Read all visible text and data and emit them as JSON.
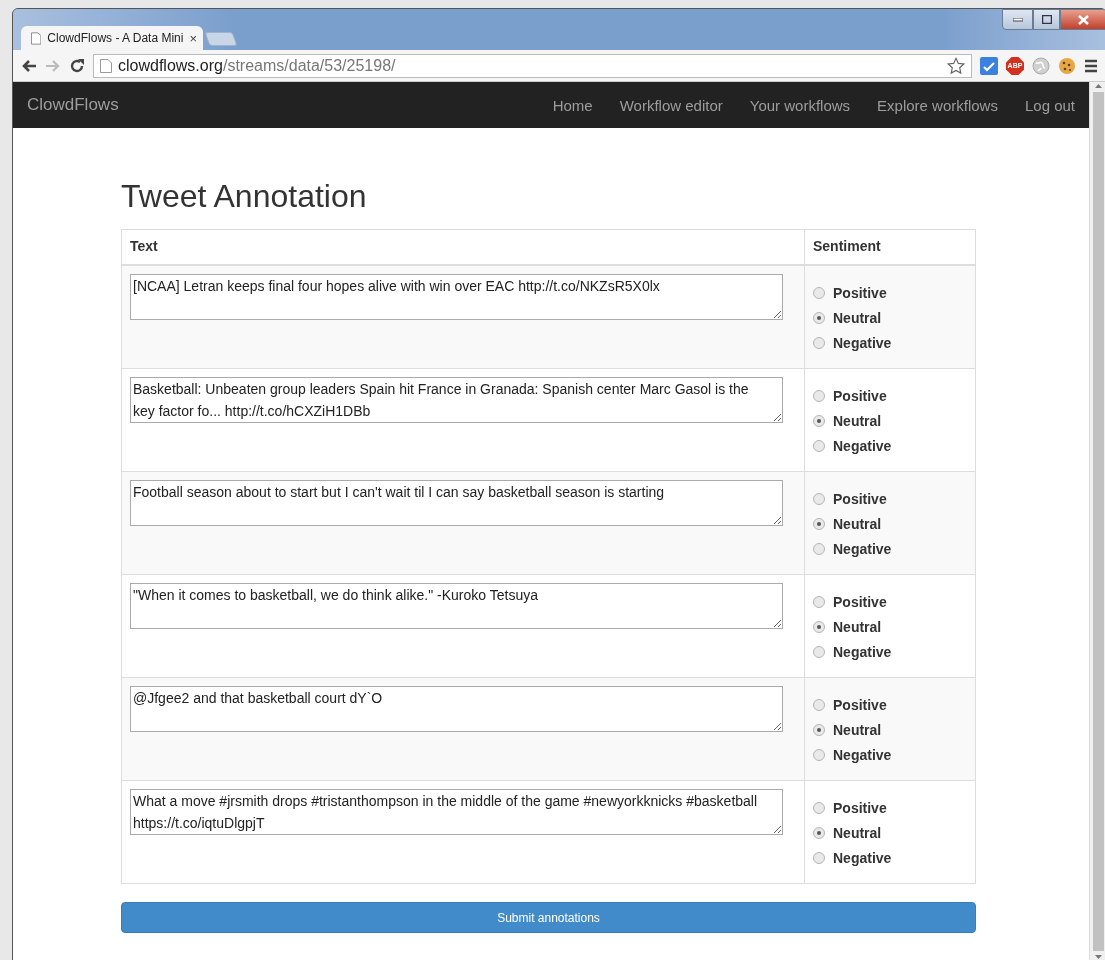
{
  "browser": {
    "tab_title": "ClowdFlows - A Data Mini",
    "tab_close": "×",
    "url_host": "clowdflows.org",
    "url_path": "/streams/data/53/25198/",
    "extension_badge": "ABP"
  },
  "navbar": {
    "brand": "ClowdFlows",
    "links": [
      "Home",
      "Workflow editor",
      "Your workflows",
      "Explore workflows",
      "Log out"
    ]
  },
  "page": {
    "title": "Tweet Annotation",
    "columns": [
      "Text",
      "Sentiment"
    ],
    "rows": [
      {
        "text": "[NCAA] Letran keeps final four hopes alive with win over EAC http://t.co/NKZsR5X0lx",
        "options": [
          {
            "label": "Positive",
            "selected": false
          },
          {
            "label": "Neutral",
            "selected": true
          },
          {
            "label": "Negative",
            "selected": false
          }
        ]
      },
      {
        "text": "Basketball: Unbeaten group leaders Spain hit France in Granada: Spanish center Marc Gasol is the key factor fo... http://t.co/hCXZiH1DBb",
        "options": [
          {
            "label": "Positive",
            "selected": false
          },
          {
            "label": "Neutral",
            "selected": true
          },
          {
            "label": "Negative",
            "selected": false
          }
        ]
      },
      {
        "text": "Football season about to start but I can't wait til I can say basketball season is starting",
        "options": [
          {
            "label": "Positive",
            "selected": false
          },
          {
            "label": "Neutral",
            "selected": true
          },
          {
            "label": "Negative",
            "selected": false
          }
        ]
      },
      {
        "text": "\"When it comes to basketball, we do think alike.\" -Kuroko Tetsuya",
        "options": [
          {
            "label": "Positive",
            "selected": false
          },
          {
            "label": "Neutral",
            "selected": true
          },
          {
            "label": "Negative",
            "selected": false
          }
        ]
      },
      {
        "text": "@Jfgee2 and that basketball court dY`O",
        "options": [
          {
            "label": "Positive",
            "selected": false
          },
          {
            "label": "Neutral",
            "selected": true
          },
          {
            "label": "Negative",
            "selected": false
          }
        ]
      },
      {
        "text": "What a move #jrsmith drops #tristanthompson in the middle of the game #newyorkknicks #basketball https://t.co/iqtuDlgpjT",
        "options": [
          {
            "label": "Positive",
            "selected": false
          },
          {
            "label": "Neutral",
            "selected": true
          },
          {
            "label": "Negative",
            "selected": false
          }
        ]
      }
    ],
    "submit": "Submit annotations"
  }
}
